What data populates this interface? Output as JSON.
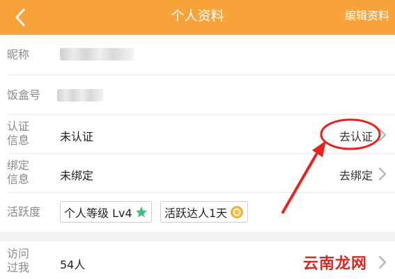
{
  "header": {
    "title": "个人资料",
    "edit_label": "编辑资料",
    "back_icon": "chevron-left-icon",
    "background_color": "#f8a23a"
  },
  "profile": {
    "nickname_label": "昵称",
    "box_id_label": "饭盒号",
    "certification": {
      "label_line1": "认证",
      "label_line2": "信息",
      "value": "未认证",
      "action": "去认证"
    },
    "binding": {
      "label_line1": "绑定",
      "label_line2": "信息",
      "value": "未绑定",
      "action": "去绑定"
    },
    "activity": {
      "label": "活跃度",
      "badges": [
        {
          "text": "个人等级 Lv4",
          "icon": "star-icon"
        },
        {
          "text": "活跃达人1天",
          "icon": "medal-icon"
        }
      ]
    },
    "visits": {
      "label_line1": "访问",
      "label_line2": "过我",
      "value": "54人"
    }
  },
  "watermark": "云南龙网",
  "annotation_color": "#e8231c"
}
